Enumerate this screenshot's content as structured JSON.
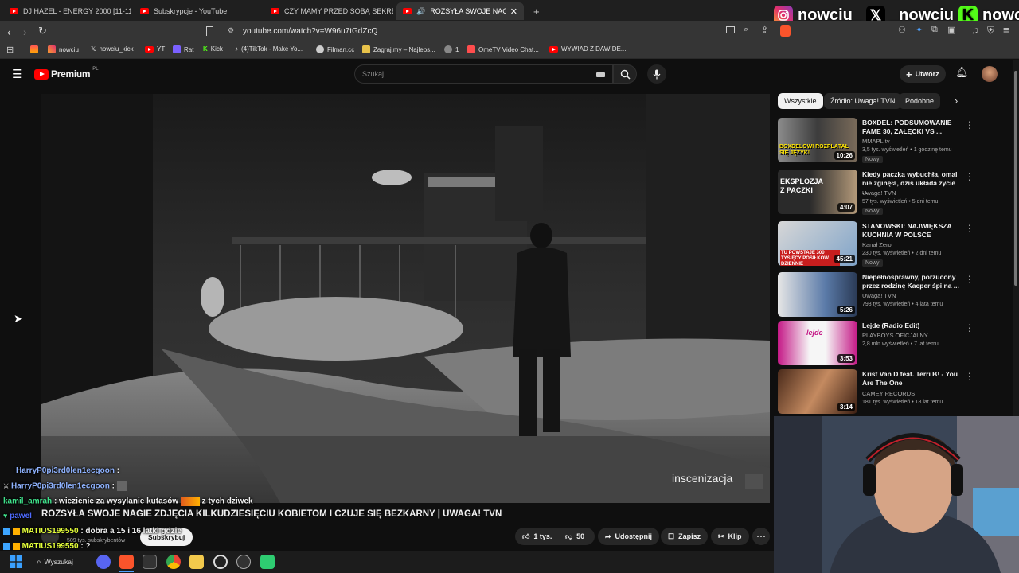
{
  "browser": {
    "tabs": [
      {
        "label": "DJ HAZEL - ENERGY 2000 [11-11"
      },
      {
        "label": "Subskrypcje - YouTube"
      },
      {
        "label": "CZY MAMY PRZED SOBĄ SEKRETY?"
      },
      {
        "label": "ROZSYŁA SWOJE NAGIE ZDJĘ"
      }
    ],
    "new_tab_label": "+",
    "url": "youtube.com/watch?v=W96u7tGdZcQ",
    "bookmarks": [
      {
        "label": "nowciu_"
      },
      {
        "label": "nowciu_kick"
      },
      {
        "label": "YT"
      },
      {
        "label": "Rat"
      },
      {
        "label": "Kick"
      },
      {
        "label": "(4)TikTok - Make Yo..."
      },
      {
        "label": "Filman.cc"
      },
      {
        "label": "Zagraj.my – Najleps..."
      },
      {
        "label": "1"
      },
      {
        "label": "OmeTV Video Chat..."
      },
      {
        "label": "WYWIAD Z DAWIDE..."
      }
    ]
  },
  "social": {
    "instagram": "nowciu_",
    "x": "_nowciu",
    "kick": "nowciu"
  },
  "youtube": {
    "logo_text": "Premium",
    "region": "PL",
    "search_placeholder": "Szukaj",
    "create_label": "Utwórz",
    "video": {
      "watermark": "inscenizacja",
      "title": "ROZSYŁA SWOJE NAGIE ZDJĘCIA KILKUDZIESIĘCIU KOBIETOM I CZUJE SIĘ BEZKARNY | UWAGA! TVN",
      "subscribers": "509 tys. subskrybentów",
      "subscribe_label": "Subskrybuj",
      "likes": "1 tys.",
      "dislikes": "50",
      "share_label": "Udostępnij",
      "save_label": "Zapisz",
      "clip_label": "Klip"
    },
    "chips": [
      {
        "label": "Wszystkie"
      },
      {
        "label": "Źródło: Uwaga! TVN"
      },
      {
        "label": "Podobne"
      }
    ],
    "recommendations": [
      {
        "title": "BOXDEL: PODSUMOWANIE FAME 30, ZAŁĘCKI VS ...",
        "channel": "MMAPL.tv",
        "meta": "3,5 tys. wyświetleń • 1 godzinę temu",
        "badge": "Nowy",
        "duration": "10:26",
        "thumb_text": "BOXDELOWI ROZPLĄTAŁ SIĘ JĘZYK!"
      },
      {
        "title": "Kiedy paczka wybuchła, omal nie zginęła, dziś układa życie ...",
        "channel": "Uwaga! TVN",
        "meta": "57 tys. wyświetleń • 5 dni temu",
        "badge": "Nowy",
        "duration": "4:07",
        "thumb_text": "EKSPLOZJA Z PACZKI"
      },
      {
        "title": "STANOWSKI: NAJWIĘKSZA KUCHNIA W POLSCE",
        "channel": "Kanał Zero",
        "meta": "230 tys. wyświetleń • 2 dni temu",
        "badge": "Nowy",
        "duration": "45:21",
        "thumb_text": "TU POWSTAJE 300 TYSIĘCY POSIŁKÓW DZIENNIE"
      },
      {
        "title": "Niepełnosprawny, porzucony przez rodzinę Kacper śpi na ...",
        "channel": "Uwaga! TVN",
        "meta": "793 tys. wyświetleń • 4 lata temu",
        "badge": "",
        "duration": "5:26",
        "thumb_text": ""
      },
      {
        "title": "Lejde (Radio Edit)",
        "channel": "PLAYBOYS OFICJALNY",
        "meta": "2,8 mln wyświetleń • 7 lat temu",
        "badge": "",
        "duration": "3:53",
        "thumb_text": "lejde"
      },
      {
        "title": "Krist Van D feat. Terri B! - You Are The One",
        "channel": "CAMEY RECORDS",
        "meta": "181 tys. wyświetleń • 18 lat temu",
        "badge": "",
        "duration": "3:14",
        "thumb_text": ""
      }
    ]
  },
  "chat": [
    {
      "user": "HarryP0pi3rd0len1ecgoon",
      "text": ":",
      "color": "#8fb3ff"
    },
    {
      "user": "HarryP0pi3rd0len1ecgoon",
      "text": ":",
      "color": "#8fb3ff"
    },
    {
      "user": "kamil_amrah",
      "text": ": wiezienie za wysylanie kutasów",
      "text2": "z tych dziwek",
      "color": "#3fe08a"
    },
    {
      "user": "pawel",
      "text": "",
      "color": "#4f6bff"
    },
    {
      "user": "MATIUS199550",
      "text": ": dobra a 15 i 16 latki gdzie",
      "color": "#e5ff3a"
    },
    {
      "user": "MATIUS199550",
      "text": ": ?",
      "color": "#e5ff3a"
    }
  ],
  "taskbar": {
    "search_label": "Wyszukaj"
  }
}
